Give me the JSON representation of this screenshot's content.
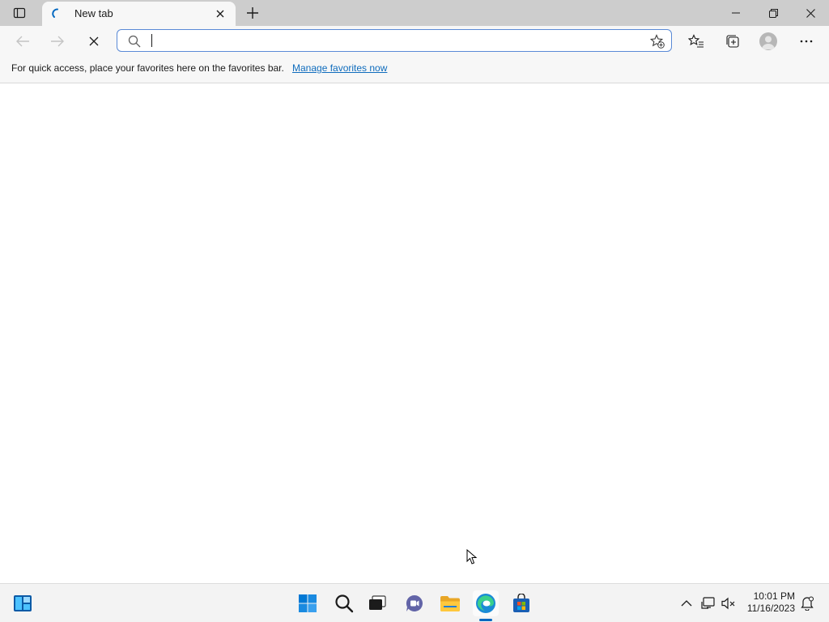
{
  "browser": {
    "tabs": [
      {
        "title": "New tab",
        "loading": true
      }
    ],
    "address_bar": {
      "value": "",
      "placeholder": ""
    },
    "favorites_bar": {
      "message": "For quick access, place your favorites here on the favorites bar.",
      "link": "Manage favorites now"
    }
  },
  "taskbar": {
    "pinned": [
      "widgets-icon",
      "start-icon",
      "search-icon",
      "task-view-icon",
      "chat-icon",
      "file-explorer-icon",
      "edge-icon",
      "store-icon"
    ],
    "active_app": "edge-icon",
    "clock": {
      "time": "10:01 PM",
      "date": "11/16/2023"
    }
  },
  "colors": {
    "accent": "#0067c0",
    "link": "#0f6cbd",
    "tab_strip": "#cdcdcd",
    "toolbar": "#f7f7f7"
  }
}
